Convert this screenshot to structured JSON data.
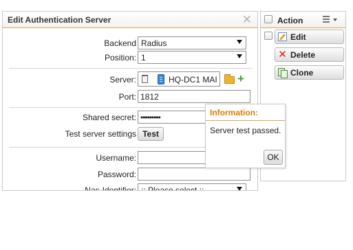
{
  "dialog": {
    "title": "Edit Authentication Server",
    "close_glyph": "✕",
    "fields": {
      "backend_label": "Backend",
      "backend_value": "Radius",
      "position_label": "Position:",
      "position_value": "1",
      "server_label": "Server:",
      "server_value": "HQ-DC1 MAI",
      "port_label": "Port:",
      "port_value": "1812",
      "secret_label": "Shared secret:",
      "secret_value": "•••••••••",
      "test_label": "Test server settings",
      "test_button": "Test",
      "username_label": "Username:",
      "username_value": "",
      "password_label": "Password:",
      "password_value": "",
      "nas_label": "Nas-Identifier:",
      "nas_value": ":: Please select ::"
    }
  },
  "action_panel": {
    "title": "Action",
    "buttons": [
      {
        "label": "Edit",
        "icon": "edit-icon"
      },
      {
        "label": "Delete",
        "icon": "delete-icon"
      },
      {
        "label": "Clone",
        "icon": "clone-icon"
      }
    ]
  },
  "popup": {
    "title": "Information:",
    "message": "Server test passed.",
    "ok_label": "OK"
  },
  "colors": {
    "accent": "#e2a64f",
    "popup_title": "#e07b00",
    "add_green": "#3fa02a",
    "delete_red": "#d2221b"
  }
}
